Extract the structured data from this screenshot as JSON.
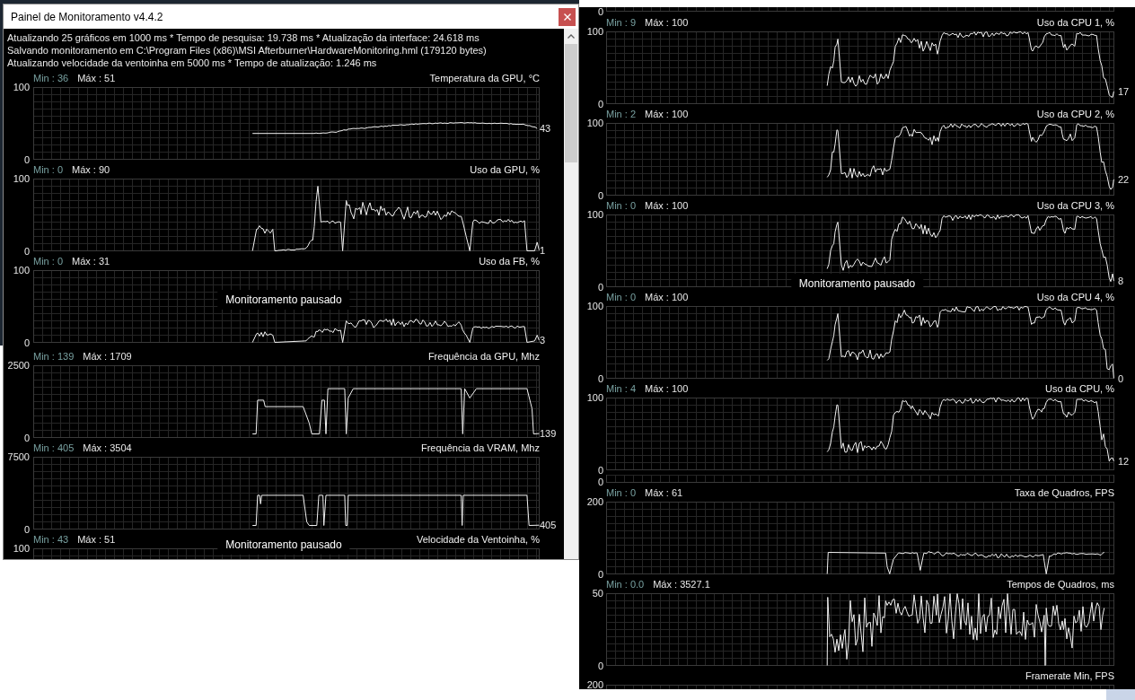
{
  "monitoring_window": {
    "title": "Painel de Monitoramento v4.4.2",
    "status_lines": [
      "Atualizando 25 gráficos em 1000 ms * Tempo de pesquisa: 19.738 ms * Atualização da interface: 24.618 ms",
      "Salvando monitoramento em C:\\Program Files (x86)\\MSI Afterburner\\HardwareMonitoring.hml (179120 bytes)",
      "Atualizando velocidade da ventoinha em 5000 ms * Tempo de atualização: 1.246 ms"
    ],
    "graphs": [
      {
        "kind": "graph",
        "min": "Min : 36",
        "max": "Máx : 51",
        "title": "Temperatura da GPU, °C",
        "y_ticks": [
          "100",
          "0"
        ],
        "current": "43"
      },
      {
        "kind": "graph",
        "min": "Min : 0",
        "max": "Máx : 90",
        "title": "Uso da GPU, %",
        "y_ticks": [
          "100",
          "0"
        ],
        "current": "1"
      },
      {
        "kind": "graph",
        "min": "Min : 0",
        "max": "Máx : 31",
        "title": "Uso da FB, %",
        "y_ticks": [
          "100",
          "0"
        ],
        "current": "3",
        "notice": "Monitoramento pausado"
      },
      {
        "kind": "graph",
        "min": "Min : 139",
        "max": "Máx : 1709",
        "title": "Frequência da GPU, Mhz",
        "y_ticks": [
          "2500",
          "0"
        ],
        "current": "139"
      },
      {
        "kind": "graph",
        "min": "Min : 405",
        "max": "Máx : 3504",
        "title": "Frequência da VRAM, Mhz",
        "y_ticks": [
          "7500",
          "0"
        ],
        "current": "405"
      },
      {
        "kind": "graph",
        "min": "Min : 43",
        "max": "Máx : 51",
        "title": "Velocidade da Ventoinha, %",
        "y_ticks": [
          "100"
        ],
        "notice": "Monitoramento pausado"
      }
    ]
  },
  "second_window": {
    "graphs": [
      {
        "kind": "stub",
        "y_ticks": [
          "0"
        ]
      },
      {
        "kind": "graph",
        "min": "Min : 9",
        "max": "Máx : 100",
        "title": "Uso da CPU 1, %",
        "y_ticks": [
          "100",
          "0"
        ],
        "current": "17"
      },
      {
        "kind": "graph",
        "min": "Min : 2",
        "max": "Máx : 100",
        "title": "Uso da CPU 2, %",
        "y_ticks": [
          "100",
          "0"
        ],
        "current": "22"
      },
      {
        "kind": "graph",
        "min": "Min : 0",
        "max": "Máx : 100",
        "title": "Uso da CPU 3, %",
        "y_ticks": [
          "100",
          "0"
        ],
        "current": "8",
        "notice": "Monitoramento pausado"
      },
      {
        "kind": "graph",
        "min": "Min : 0",
        "max": "Máx : 100",
        "title": "Uso da CPU 4, %",
        "y_ticks": [
          "100",
          "0"
        ],
        "current": "0"
      },
      {
        "kind": "graph",
        "min": "Min : 4",
        "max": "Máx : 100",
        "title": "Uso da CPU, %",
        "y_ticks": [
          "100",
          "0"
        ],
        "current": "12"
      },
      {
        "kind": "stub",
        "y_ticks": [
          "0"
        ]
      },
      {
        "kind": "graph",
        "min": "Min : 0",
        "max": "Máx : 61",
        "title": "Taxa de Quadros, FPS",
        "y_ticks": [
          "200",
          "0"
        ]
      },
      {
        "kind": "graph",
        "min": "Min : 0.0",
        "max": "Máx : 3527.1",
        "title": "Tempos de Quadros, ms",
        "y_ticks": [
          "50",
          "0"
        ]
      },
      {
        "kind": "graph",
        "title": "Framerate Min, FPS",
        "y_ticks": [
          "200"
        ]
      }
    ]
  }
}
